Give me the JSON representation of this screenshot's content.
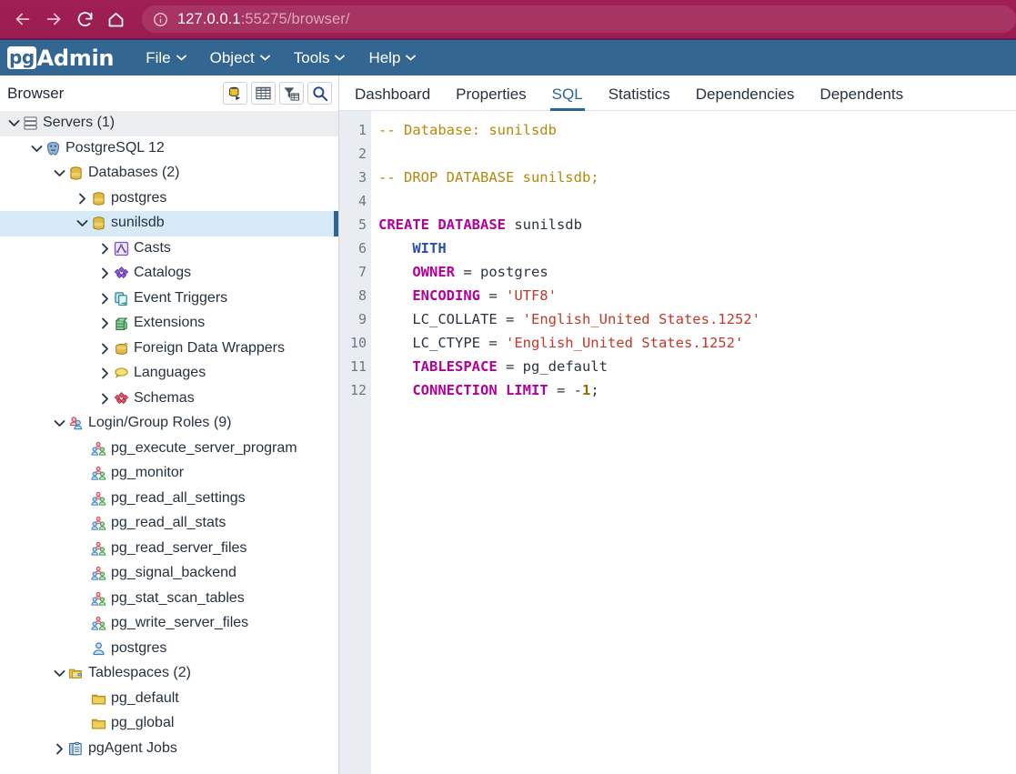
{
  "browser": {
    "back_icon": "arrow-left-icon",
    "forward_icon": "arrow-right-icon",
    "reload_icon": "reload-icon",
    "home_icon": "home-icon",
    "site_info_icon": "info-circle-icon",
    "url_host": "127.0.0.1",
    "url_rest": ":55275/browser/",
    "url_full": "127.0.0.1:55275/browser/",
    "chrome_color": "#9d1e50"
  },
  "navbar": {
    "brand_pg": "pg",
    "brand_admin": "Admin",
    "background": "#336690",
    "menus": [
      {
        "label": "File"
      },
      {
        "label": "Object"
      },
      {
        "label": "Tools"
      },
      {
        "label": "Help"
      }
    ]
  },
  "browser_panel": {
    "title": "Browser",
    "toolbar": [
      {
        "name": "query-tool-button",
        "icon": "database-arrow-icon"
      },
      {
        "name": "view-data-button",
        "icon": "grid-icon"
      },
      {
        "name": "filtered-rows-button",
        "icon": "funnel-grid-icon"
      },
      {
        "name": "search-objects-button",
        "icon": "search-icon"
      }
    ]
  },
  "tree": {
    "selected": "sunilsdb",
    "selection_color": "#d6eaf8",
    "selection_marker_color": "#2c6496",
    "nodes": [
      {
        "label": "Servers (1)",
        "indent": 0,
        "state": "open",
        "icon": "servers-icon",
        "row": "head"
      },
      {
        "label": "PostgreSQL 12",
        "indent": 1,
        "state": "open",
        "icon": "postgres-icon"
      },
      {
        "label": "Databases (2)",
        "indent": 2,
        "state": "open",
        "icon": "database-icon"
      },
      {
        "label": "postgres",
        "indent": 3,
        "state": "closed",
        "icon": "database-icon"
      },
      {
        "label": "sunilsdb",
        "indent": 3,
        "state": "open",
        "icon": "database-icon",
        "row": "sel"
      },
      {
        "label": "Casts",
        "indent": 4,
        "state": "closed",
        "icon": "cast-icon"
      },
      {
        "label": "Catalogs",
        "indent": 4,
        "state": "closed",
        "icon": "catalog-icon"
      },
      {
        "label": "Event Triggers",
        "indent": 4,
        "state": "closed",
        "icon": "event-trigger-icon"
      },
      {
        "label": "Extensions",
        "indent": 4,
        "state": "closed",
        "icon": "extension-icon"
      },
      {
        "label": "Foreign Data Wrappers",
        "indent": 4,
        "state": "closed",
        "icon": "foreign-data-wrapper-icon"
      },
      {
        "label": "Languages",
        "indent": 4,
        "state": "closed",
        "icon": "language-icon"
      },
      {
        "label": "Schemas",
        "indent": 4,
        "state": "closed",
        "icon": "schema-icon"
      },
      {
        "label": "Login/Group Roles (9)",
        "indent": 2,
        "state": "open",
        "icon": "login-group-roles-icon"
      },
      {
        "label": "pg_execute_server_program",
        "indent": 3,
        "state": "leaf",
        "icon": "group-role-icon"
      },
      {
        "label": "pg_monitor",
        "indent": 3,
        "state": "leaf",
        "icon": "group-role-icon"
      },
      {
        "label": "pg_read_all_settings",
        "indent": 3,
        "state": "leaf",
        "icon": "group-role-icon"
      },
      {
        "label": "pg_read_all_stats",
        "indent": 3,
        "state": "leaf",
        "icon": "group-role-icon"
      },
      {
        "label": "pg_read_server_files",
        "indent": 3,
        "state": "leaf",
        "icon": "group-role-icon"
      },
      {
        "label": "pg_signal_backend",
        "indent": 3,
        "state": "leaf",
        "icon": "group-role-icon"
      },
      {
        "label": "pg_stat_scan_tables",
        "indent": 3,
        "state": "leaf",
        "icon": "group-role-icon"
      },
      {
        "label": "pg_write_server_files",
        "indent": 3,
        "state": "leaf",
        "icon": "group-role-icon"
      },
      {
        "label": "postgres",
        "indent": 3,
        "state": "leaf",
        "icon": "login-role-icon"
      },
      {
        "label": "Tablespaces (2)",
        "indent": 2,
        "state": "open",
        "icon": "tablespaces-icon"
      },
      {
        "label": "pg_default",
        "indent": 3,
        "state": "leaf",
        "icon": "tablespace-icon"
      },
      {
        "label": "pg_global",
        "indent": 3,
        "state": "leaf",
        "icon": "tablespace-icon"
      },
      {
        "label": "pgAgent Jobs",
        "indent": 2,
        "state": "closed",
        "icon": "pgagent-jobs-icon"
      }
    ]
  },
  "tabs": [
    {
      "label": "Dashboard",
      "active": false
    },
    {
      "label": "Properties",
      "active": false
    },
    {
      "label": "SQL",
      "active": true
    },
    {
      "label": "Statistics",
      "active": false
    },
    {
      "label": "Dependencies",
      "active": false
    },
    {
      "label": "Dependents",
      "active": false
    }
  ],
  "sql_editor": {
    "active_tab": "SQL",
    "line_count": 12,
    "line_numbers": [
      "1",
      "2",
      "3",
      "4",
      "5",
      "6",
      "7",
      "8",
      "9",
      "10",
      "11",
      "12"
    ],
    "plain_text": "-- Database: sunilsdb\n\n-- DROP DATABASE sunilsdb;\n\nCREATE DATABASE sunilsdb\n    WITH \n    OWNER = postgres\n    ENCODING = 'UTF8'\n    LC_COLLATE = 'English_United States.1252'\n    LC_CTYPE = 'English_United States.1252'\n    TABLESPACE = pg_default\n    CONNECTION LIMIT = -1;",
    "lines": [
      {
        "n": "1",
        "tokens": [
          {
            "t": "-- Database: sunilsdb",
            "c": "comment"
          }
        ]
      },
      {
        "n": "2",
        "tokens": []
      },
      {
        "n": "3",
        "tokens": [
          {
            "t": "-- DROP DATABASE sunilsdb;",
            "c": "comment"
          }
        ]
      },
      {
        "n": "4",
        "tokens": []
      },
      {
        "n": "5",
        "tokens": [
          {
            "t": "CREATE DATABASE",
            "c": "kw"
          },
          {
            "t": " sunilsdb",
            "c": "plain"
          }
        ]
      },
      {
        "n": "6",
        "tokens": [
          {
            "t": "    ",
            "c": "plain"
          },
          {
            "t": "WITH",
            "c": "kw2"
          }
        ]
      },
      {
        "n": "7",
        "tokens": [
          {
            "t": "    ",
            "c": "plain"
          },
          {
            "t": "OWNER",
            "c": "kw"
          },
          {
            "t": " = ",
            "c": "op"
          },
          {
            "t": "postgres",
            "c": "plain"
          }
        ]
      },
      {
        "n": "8",
        "tokens": [
          {
            "t": "    ",
            "c": "plain"
          },
          {
            "t": "ENCODING",
            "c": "kw"
          },
          {
            "t": " = ",
            "c": "op"
          },
          {
            "t": "'UTF8'",
            "c": "str"
          }
        ]
      },
      {
        "n": "9",
        "tokens": [
          {
            "t": "    ",
            "c": "plain"
          },
          {
            "t": "LC_COLLATE",
            "c": "plain"
          },
          {
            "t": " = ",
            "c": "op"
          },
          {
            "t": "'English_United States.1252'",
            "c": "str"
          }
        ]
      },
      {
        "n": "10",
        "tokens": [
          {
            "t": "    ",
            "c": "plain"
          },
          {
            "t": "LC_CTYPE",
            "c": "plain"
          },
          {
            "t": " = ",
            "c": "op"
          },
          {
            "t": "'English_United States.1252'",
            "c": "str"
          }
        ]
      },
      {
        "n": "11",
        "tokens": [
          {
            "t": "    ",
            "c": "plain"
          },
          {
            "t": "TABLESPACE",
            "c": "kw"
          },
          {
            "t": " = ",
            "c": "op"
          },
          {
            "t": "pg_default",
            "c": "plain"
          }
        ]
      },
      {
        "n": "12",
        "tokens": [
          {
            "t": "    ",
            "c": "plain"
          },
          {
            "t": "CONNECTION LIMIT",
            "c": "kw"
          },
          {
            "t": " = ",
            "c": "op"
          },
          {
            "t": "-",
            "c": "op"
          },
          {
            "t": "1",
            "c": "num"
          },
          {
            "t": ";",
            "c": "op"
          }
        ]
      }
    ],
    "syntax_colors": {
      "comment": "#b8860b",
      "keyword": "#b3009b",
      "keyword_secondary": "#2c4ea8",
      "string": "#c0392b",
      "number": "#9a6a00",
      "identifier": "#2b3440",
      "gutter_bg": "#e9ecf1"
    }
  }
}
